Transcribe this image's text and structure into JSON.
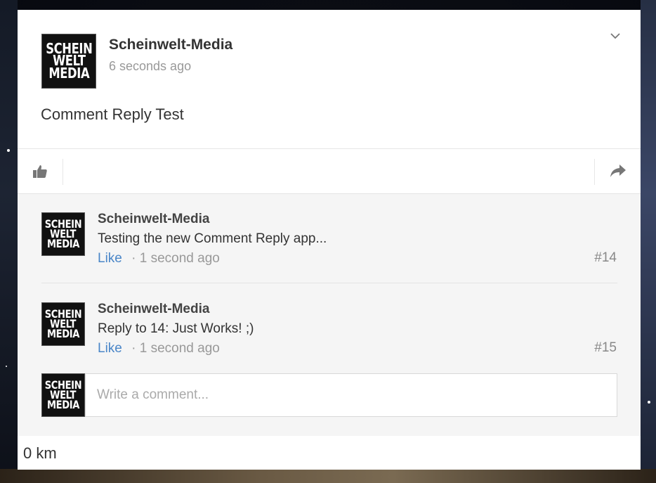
{
  "post": {
    "author": "Scheinwelt-Media",
    "logo_lines": [
      "SCHEIN",
      "WELT",
      "MEDIA"
    ],
    "timestamp": "6 seconds ago",
    "text": "Comment Reply Test"
  },
  "comments": [
    {
      "author": "Scheinwelt-Media",
      "text": "Testing the new Comment Reply app...",
      "like_label": "Like",
      "time": "· 1 second ago",
      "number": "#14"
    },
    {
      "author": "Scheinwelt-Media",
      "text": "Reply to 14: Just Works! ;)",
      "like_label": "Like",
      "time": "· 1 second ago",
      "number": "#15"
    }
  ],
  "composer": {
    "placeholder": "Write a comment..."
  },
  "footer": {
    "distance": "0 km"
  },
  "colors": {
    "link": "#4a86c8",
    "background": "#0c0e14",
    "card": "#ffffff"
  },
  "icons": [
    "chevron-down-icon",
    "thumbs-up-icon",
    "share-icon"
  ]
}
